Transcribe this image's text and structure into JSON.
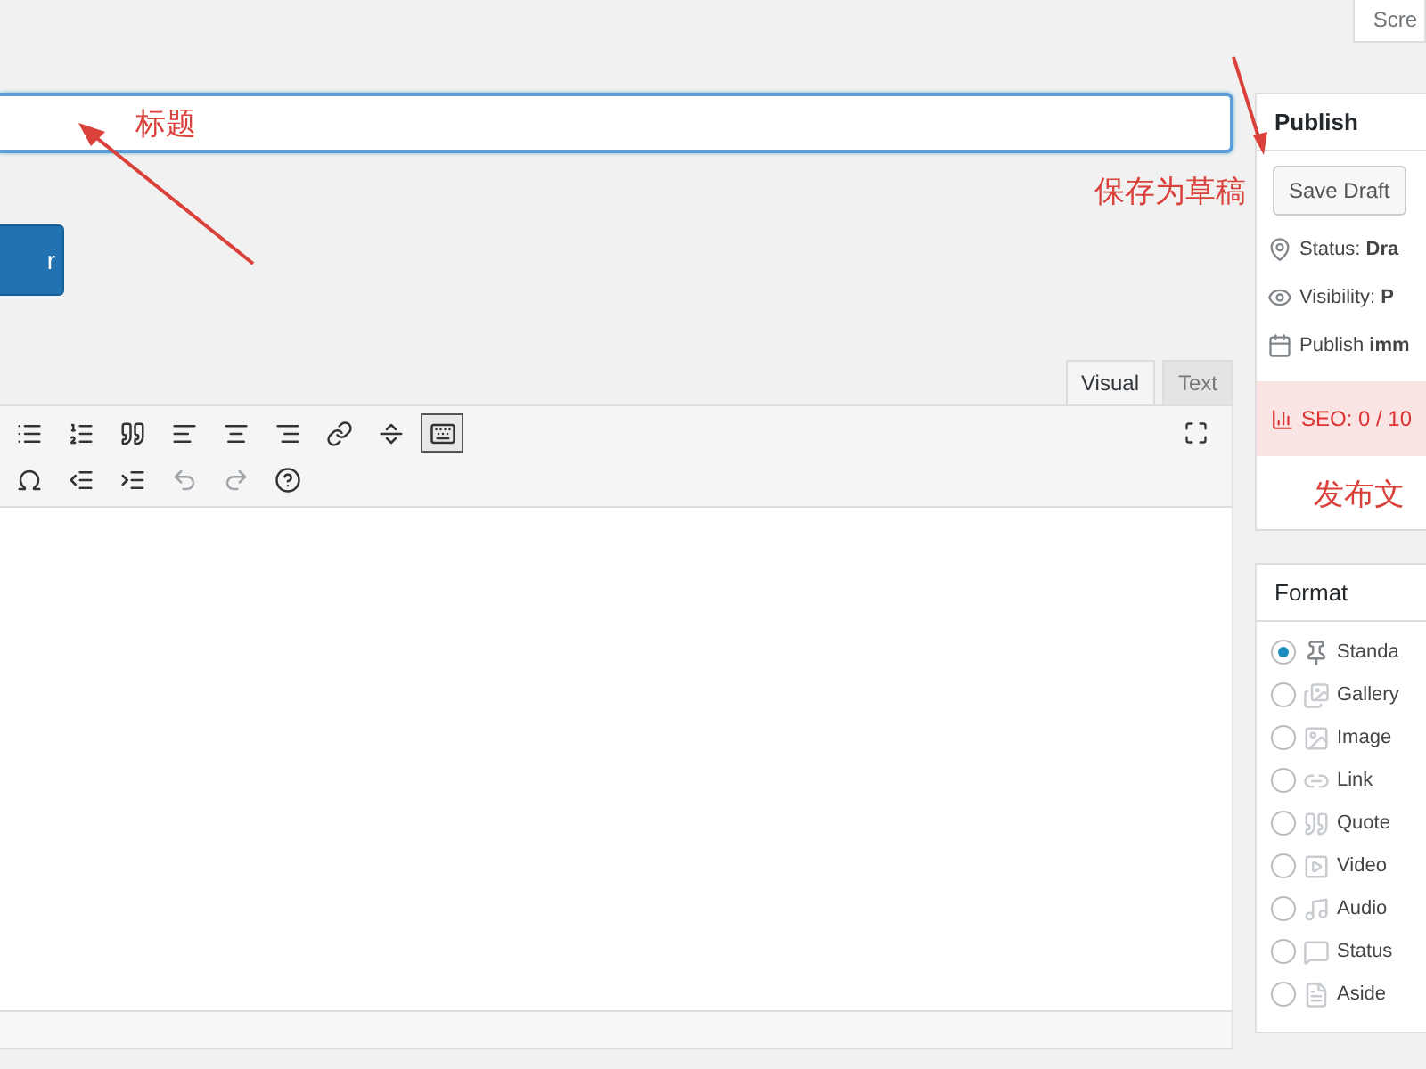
{
  "screen_options": {
    "label": "Scre"
  },
  "primary_button": {
    "label": "r"
  },
  "editor": {
    "tabs": [
      {
        "label": "Visual",
        "selected": true
      },
      {
        "label": "Text",
        "selected": false
      }
    ],
    "toolbar_row_1": [
      {
        "pressed": false
      },
      {
        "pressed": false
      },
      {
        "pressed": false
      },
      {
        "pressed": false
      },
      {
        "pressed": false
      },
      {
        "pressed": false
      },
      {
        "pressed": false
      },
      {
        "pressed": false
      },
      {
        "pressed": true
      }
    ],
    "toolbar_row_2": [
      {
        "disabled": false
      },
      {
        "disabled": false
      },
      {
        "disabled": false
      },
      {
        "disabled": true
      },
      {
        "disabled": true
      },
      {
        "disabled": false
      }
    ]
  },
  "publish": {
    "title": "Publish",
    "save_draft": "Save Draft",
    "rows": [
      "Status: **Dra**",
      "Visibility: **P**",
      "Publish **imm**"
    ],
    "seo": "SEO: 0 / 10"
  },
  "format": {
    "title": "Format",
    "options": [
      {
        "label": "Standa",
        "selected": true
      },
      {
        "label": "Gallery",
        "selected": false
      },
      {
        "label": "Image",
        "selected": false
      },
      {
        "label": "Link",
        "selected": false
      },
      {
        "label": "Quote",
        "selected": false
      },
      {
        "label": "Video",
        "selected": false
      },
      {
        "label": "Audio",
        "selected": false
      },
      {
        "label": "Status",
        "selected": false
      },
      {
        "label": "Aside",
        "selected": false
      }
    ]
  },
  "annotations": {
    "title_note": "标题",
    "save_note": "保存为草稿",
    "publish_note": "发布文"
  }
}
